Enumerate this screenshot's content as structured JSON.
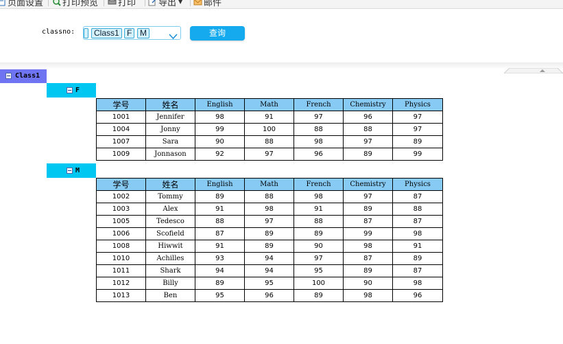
{
  "toolbar": {
    "items": [
      {
        "label": "页面设置",
        "icon": "page-setup-icon"
      },
      {
        "label": "打印预览",
        "icon": "print-preview-icon"
      },
      {
        "label": "打印",
        "icon": "printer-icon"
      },
      {
        "label": "导出",
        "icon": "export-icon",
        "has_dropdown": true
      },
      {
        "label": "邮件",
        "icon": "mail-icon"
      }
    ]
  },
  "query": {
    "classno_label": "classno:",
    "selected_tags": [
      "Class1",
      "F",
      "M"
    ],
    "submit_label": "查询"
  },
  "colors": {
    "accent": "#15aaee",
    "header_row": "#87cbf5",
    "group_level1": "#6f74f3",
    "group_level2": "#00c6f2"
  },
  "report": {
    "group_label": "Class1",
    "columns": [
      "学号",
      "姓名",
      "English",
      "Math",
      "French",
      "Chemistry",
      "Physics"
    ],
    "subgroups": [
      {
        "label": "F",
        "rows": [
          [
            "1001",
            "Jennifer",
            "98",
            "91",
            "97",
            "96",
            "97"
          ],
          [
            "1004",
            "Jonny",
            "99",
            "100",
            "88",
            "88",
            "97"
          ],
          [
            "1007",
            "Sara",
            "90",
            "88",
            "98",
            "97",
            "89"
          ],
          [
            "1009",
            "Jonnason",
            "92",
            "97",
            "96",
            "89",
            "99"
          ]
        ]
      },
      {
        "label": "M",
        "rows": [
          [
            "1002",
            "Tommy",
            "89",
            "88",
            "98",
            "97",
            "87"
          ],
          [
            "1003",
            "Alex",
            "91",
            "98",
            "91",
            "89",
            "88"
          ],
          [
            "1005",
            "Tedesco",
            "88",
            "97",
            "88",
            "87",
            "87"
          ],
          [
            "1006",
            "Scofield",
            "87",
            "89",
            "89",
            "99",
            "98"
          ],
          [
            "1008",
            "Hiwwit",
            "91",
            "89",
            "90",
            "98",
            "91"
          ],
          [
            "1010",
            "Achilles",
            "93",
            "94",
            "97",
            "87",
            "89"
          ],
          [
            "1011",
            "Shark",
            "94",
            "94",
            "95",
            "89",
            "87"
          ],
          [
            "1012",
            "Billy",
            "89",
            "95",
            "100",
            "90",
            "98"
          ],
          [
            "1013",
            "Ben",
            "95",
            "96",
            "89",
            "98",
            "96"
          ]
        ]
      }
    ]
  }
}
